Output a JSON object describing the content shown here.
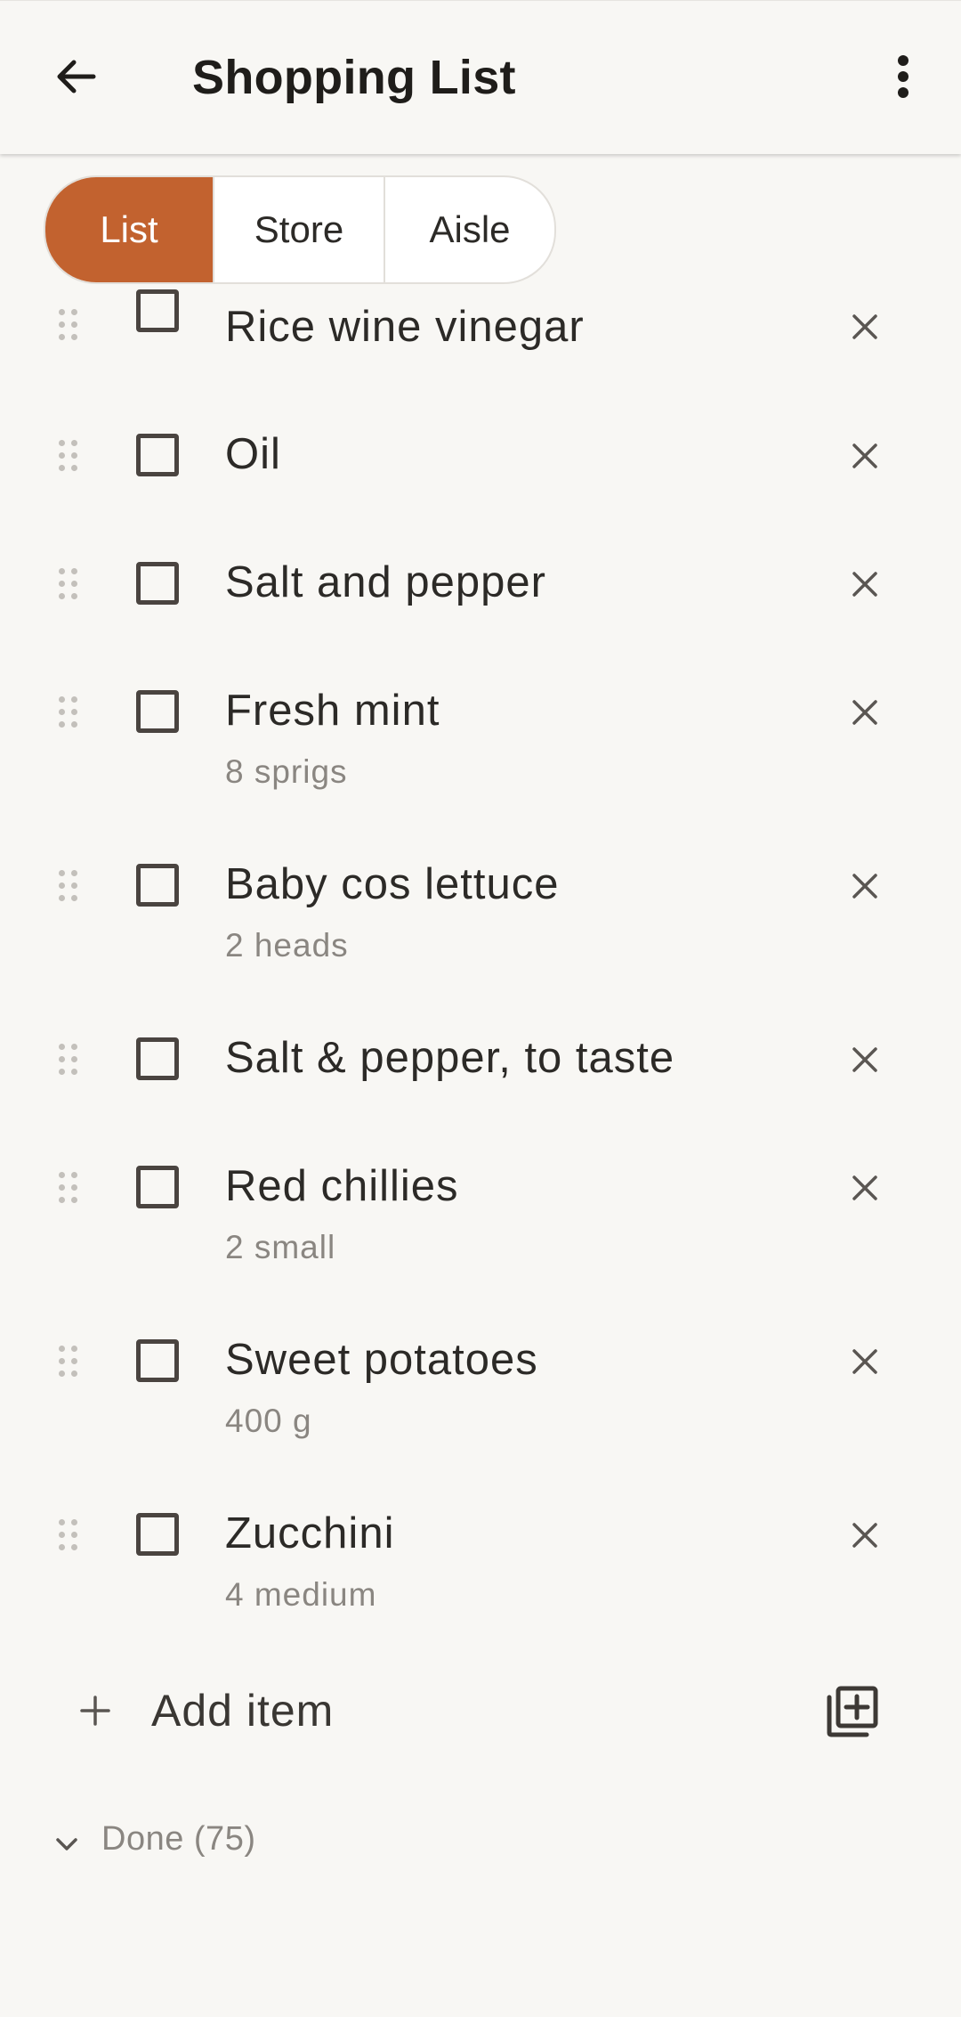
{
  "appbar": {
    "title": "Shopping List",
    "back_icon": "arrow-left-icon",
    "menu_icon": "more-vert-icon"
  },
  "tabs": [
    {
      "label": "List",
      "active": true
    },
    {
      "label": "Store",
      "active": false
    },
    {
      "label": "Aisle",
      "active": false
    }
  ],
  "items": [
    {
      "name": "Rice wine vinegar",
      "qty": ""
    },
    {
      "name": "Oil",
      "qty": ""
    },
    {
      "name": "Salt and pepper",
      "qty": ""
    },
    {
      "name": "Fresh mint",
      "qty": "8 sprigs"
    },
    {
      "name": "Baby cos lettuce",
      "qty": "2 heads"
    },
    {
      "name": "Salt & pepper, to taste",
      "qty": ""
    },
    {
      "name": "Red chillies",
      "qty": "2 small"
    },
    {
      "name": "Sweet potatoes",
      "qty": "400 g"
    },
    {
      "name": "Zucchini",
      "qty": "4 medium"
    }
  ],
  "add_item": {
    "label": "Add item",
    "bulk_icon": "library-add-icon"
  },
  "done": {
    "label": "Done (75)"
  },
  "colors": {
    "accent": "#c2622f",
    "background": "#f8f7f4"
  }
}
